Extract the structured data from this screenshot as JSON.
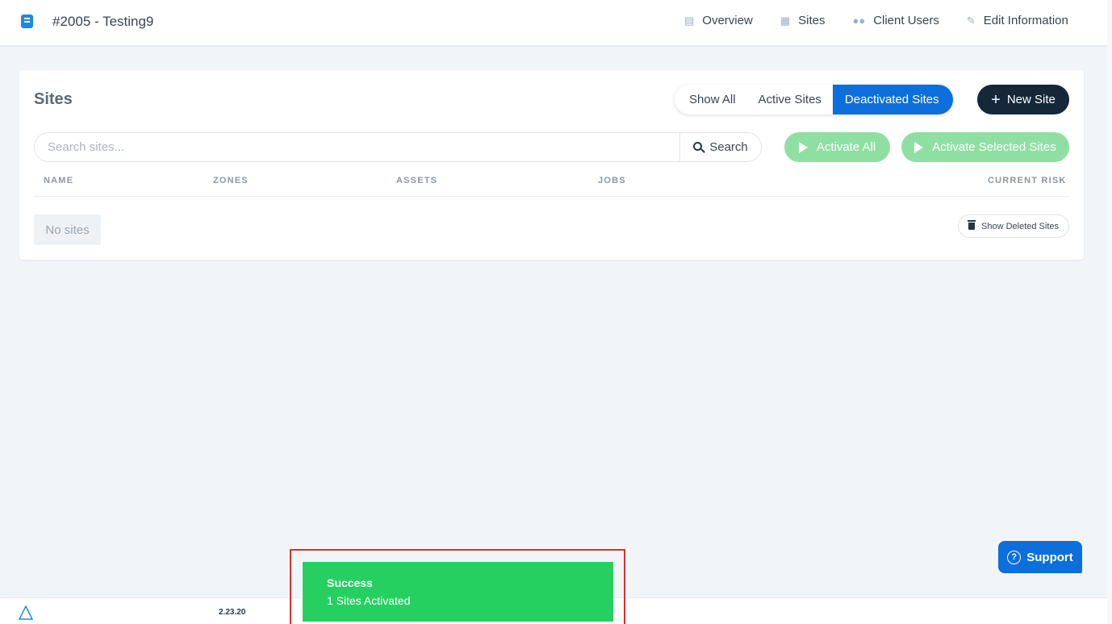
{
  "header": {
    "client_title": "#2005 - Testing9",
    "nav": [
      {
        "label": "Overview",
        "icon": "chart-icon"
      },
      {
        "label": "Sites",
        "icon": "building-icon"
      },
      {
        "label": "Client Users",
        "icon": "users-icon"
      },
      {
        "label": "Edit Information",
        "icon": "pencil-icon"
      }
    ]
  },
  "sites": {
    "title": "Sites",
    "filters": [
      "Show All",
      "Active Sites",
      "Deactivated Sites"
    ],
    "active_filter": "Deactivated Sites",
    "new_site_label": "New Site",
    "search_placeholder": "Search sites...",
    "search_label": "Search",
    "activate_all_label": "Activate All",
    "activate_selected_label": "Activate Selected Sites",
    "columns": [
      "NAME",
      "ZONES",
      "ASSETS",
      "JOBS",
      "CURRENT RISK"
    ],
    "empty_text": "No sites",
    "show_deleted_label": "Show Deleted Sites"
  },
  "support_label": "Support",
  "footer": {
    "version": "2.23.20"
  },
  "toast": {
    "title": "Success",
    "message": "1 Sites Activated"
  },
  "colors": {
    "primary": "#0d6fdc",
    "dark": "#15283a",
    "success": "#25d060",
    "activate_disabled": "#8fdfa3"
  }
}
